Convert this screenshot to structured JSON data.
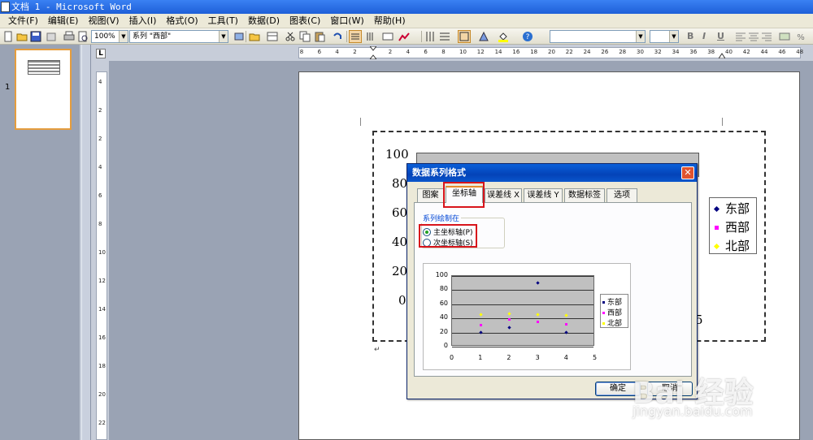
{
  "window": {
    "title": "文档 1 - Microsoft Word"
  },
  "menu": [
    "文件(F)",
    "编辑(E)",
    "视图(V)",
    "插入(I)",
    "格式(O)",
    "工具(T)",
    "数据(D)",
    "图表(C)",
    "窗口(W)",
    "帮助(H)"
  ],
  "toolbar": {
    "zoom": "100%",
    "series_selector": "系列 \"西部\"",
    "font_name": "",
    "font_size": "",
    "bold": "B",
    "italic": "I",
    "underline": "U"
  },
  "thumbnail": {
    "page_number": "1"
  },
  "rulers": {
    "horizontal": [
      "8",
      "6",
      "4",
      "2",
      "2",
      "4",
      "6",
      "8",
      "10",
      "12",
      "14",
      "16",
      "18",
      "20",
      "22",
      "24",
      "26",
      "28",
      "30",
      "32",
      "34",
      "36",
      "38",
      "40",
      "42",
      "44",
      "46",
      "48"
    ],
    "vertical": [
      "4",
      "2",
      "2",
      "4",
      "6",
      "8",
      "10",
      "12",
      "14",
      "16",
      "18",
      "20",
      "22"
    ],
    "corner": "L"
  },
  "background_chart": {
    "y_ticks": [
      "100",
      "80",
      "60",
      "40",
      "20",
      "0"
    ],
    "partial_x_tick": "5",
    "legend": [
      {
        "label": "东部",
        "color": "#000080"
      },
      {
        "label": "西部",
        "color": "#ff00ff"
      },
      {
        "label": "北部",
        "color": "#ffff00"
      }
    ]
  },
  "dialog": {
    "title": "数据系列格式",
    "close_label": "✕",
    "tabs": [
      "图案",
      "坐标轴",
      "误差线 X",
      "误差线 Y",
      "数据标签",
      "选项"
    ],
    "active_tab": "坐标轴",
    "group_label": "系列绘制在",
    "radio_options": [
      {
        "label": "主坐标轴(P)",
        "checked": true
      },
      {
        "label": "次坐标轴(S)",
        "checked": false
      }
    ],
    "ok_label": "确定",
    "cancel_label": "取消"
  },
  "chart_data": {
    "type": "scatter",
    "title": "",
    "xlabel": "",
    "ylabel": "",
    "x_ticks": [
      "0",
      "1",
      "2",
      "3",
      "4",
      "5"
    ],
    "y_ticks": [
      "0",
      "20",
      "40",
      "60",
      "80",
      "100"
    ],
    "xlim": [
      0,
      5
    ],
    "ylim": [
      0,
      100
    ],
    "grid": true,
    "legend_position": "right",
    "series": [
      {
        "name": "东部",
        "color": "#000080",
        "x": [
          1,
          2,
          3,
          4
        ],
        "y": [
          20,
          27,
          90,
          20
        ]
      },
      {
        "name": "西部",
        "color": "#ff00ff",
        "x": [
          1,
          2,
          3,
          4
        ],
        "y": [
          31,
          39,
          35,
          32
        ]
      },
      {
        "name": "北部",
        "color": "#ffff00",
        "x": [
          1,
          2,
          3,
          4
        ],
        "y": [
          45,
          46,
          45,
          44
        ]
      }
    ]
  },
  "watermark": {
    "main": "Bai 经验",
    "sub": "jingyan.baidu.com"
  }
}
